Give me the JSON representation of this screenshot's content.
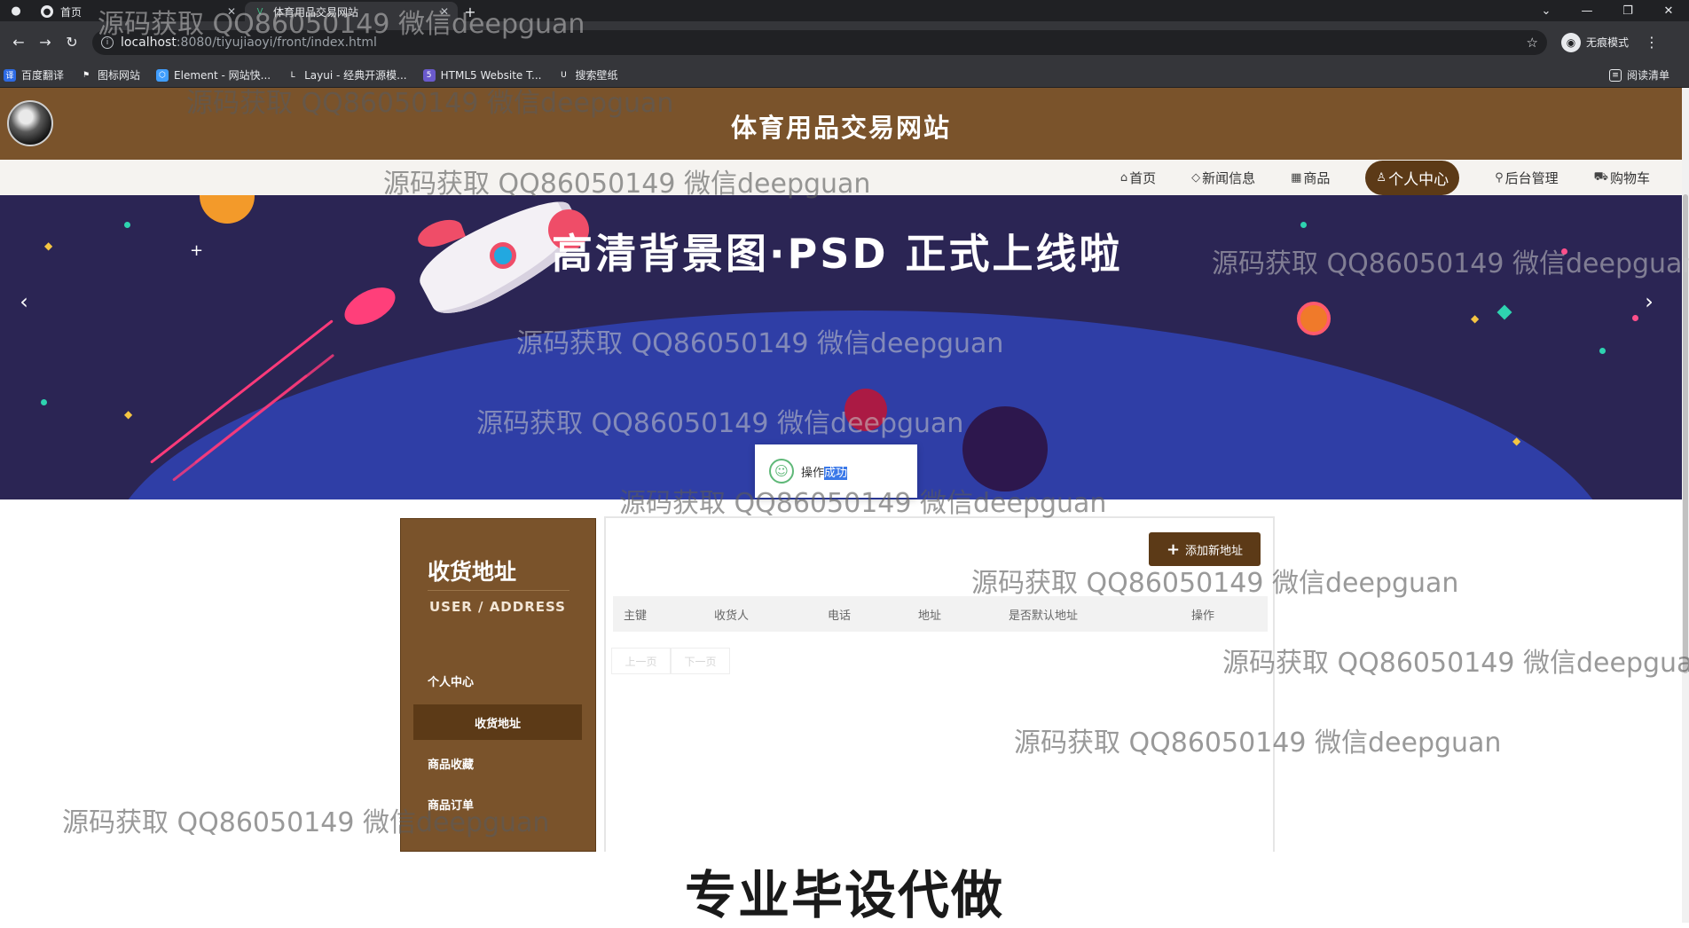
{
  "browser": {
    "tabs": [
      {
        "title": "首页",
        "active": false
      },
      {
        "title": "体育用品交易网站",
        "active": true
      }
    ],
    "url_host": "localhost",
    "url_path": ":8080/tiyujiaoyi/front/index.html",
    "incognito_label": "无痕模式",
    "bookmarks": [
      "百度翻译",
      "图标网站",
      "Element - 网站快...",
      "Layui - 经典开源模...",
      "HTML5 Website T...",
      "搜索壁纸"
    ],
    "reading_list": "阅读清单"
  },
  "site": {
    "title": "体育用品交易网站",
    "nav": [
      {
        "label": "首页",
        "icon": "home-icon",
        "active": false
      },
      {
        "label": "新闻信息",
        "icon": "tag-icon",
        "active": false
      },
      {
        "label": "商品",
        "icon": "grid-icon",
        "active": false
      },
      {
        "label": "个人中心",
        "icon": "user-icon",
        "active": true
      },
      {
        "label": "后台管理",
        "icon": "link-icon",
        "active": false
      },
      {
        "label": "购物车",
        "icon": "cart-icon",
        "active": false
      }
    ]
  },
  "banner": {
    "headline": "高清背景图·PSD 正式上线啦"
  },
  "toast": {
    "text_plain": "操作",
    "text_selected": "成功"
  },
  "sidebar": {
    "title": "收货地址",
    "subtitle": "USER / ADDRESS",
    "items": [
      {
        "label": "个人中心",
        "active": false
      },
      {
        "label": "收货地址",
        "active": true
      },
      {
        "label": "商品收藏",
        "active": false
      },
      {
        "label": "商品订单",
        "active": false
      }
    ]
  },
  "address_table": {
    "add_button": "添加新地址",
    "columns": [
      "主键",
      "收货人",
      "电话",
      "地址",
      "是否默认地址",
      "操作"
    ],
    "rows": [],
    "pager": {
      "prev": "上一页",
      "next": "下一页"
    }
  },
  "watermark": "源码获取 QQ86050149 微信deepguan",
  "caption": "专业毕设代做",
  "colors": {
    "brand_brown": "#7a532b",
    "brand_dark": "#5c3a17",
    "banner_bg": "#2b2554",
    "planet": "#2f3ea6"
  }
}
